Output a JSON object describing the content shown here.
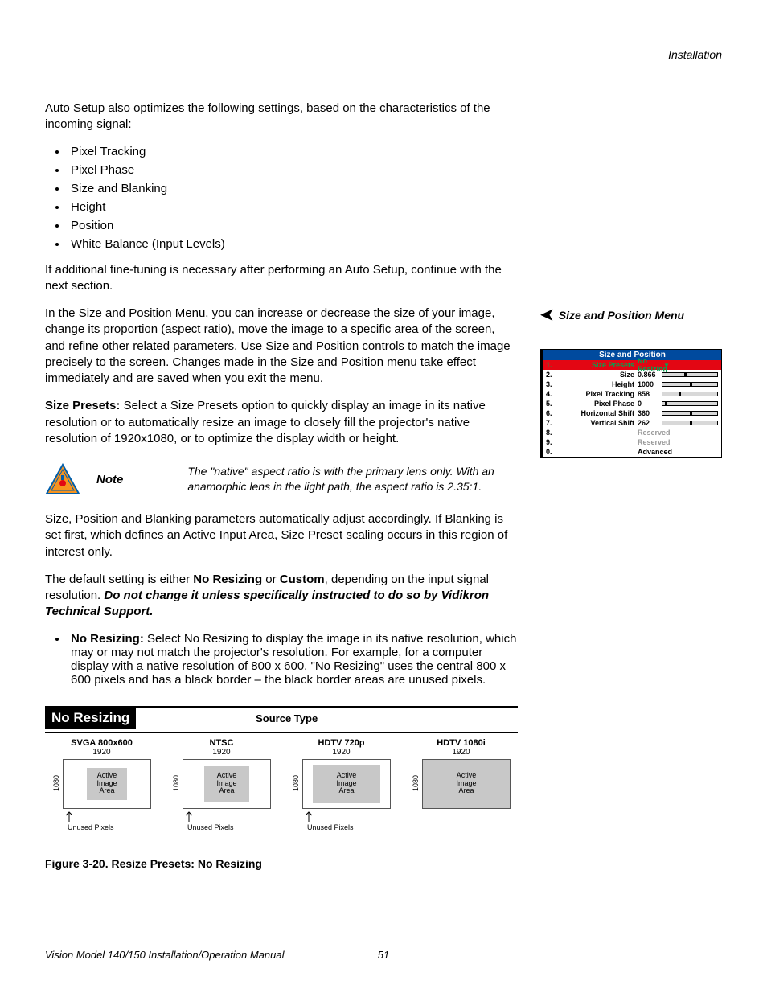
{
  "header": {
    "section": "Installation"
  },
  "intro": {
    "auto_setup": "Auto Setup also optimizes the following settings, based on the characteristics of the incoming signal:",
    "bullets": [
      "Pixel Tracking",
      "Pixel Phase",
      "Size and Blanking",
      "Height",
      "Position",
      "White Balance (Input Levels)"
    ],
    "fine_tune": "If additional fine-tuning is necessary after performing an Auto Setup, continue with the next section."
  },
  "size_pos": {
    "heading": "Size and Position Menu",
    "para": "In the Size and Position Menu, you can increase or decrease the size of your image, change its proportion (aspect ratio), move the image to a specific area of the screen, and refine other related parameters. Use Size and Position controls to match the image precisely to the screen. Changes made in the Size and Position menu take effect immediately and are saved when you exit the menu.",
    "presets_label": "Size Presets: ",
    "presets_text": "Select a Size Presets option to quickly display an image in its native resolution or to automatically resize an image to closely fill the projector's native resolution of 1920x1080, or to optimize the display width or height."
  },
  "note": {
    "label": "Note",
    "text": "The \"native\" aspect ratio is with the primary lens only. With an anamorphic lens in the light path, the aspect ratio is 2.35:1."
  },
  "blanking_para": "Size, Position and Blanking parameters automatically adjust accordingly. If Blanking is set first, which defines an Active Input Area, Size Preset scaling occurs in this region of interest only.",
  "default": {
    "pre": "The default setting is either ",
    "b1": "No Resizing",
    "mid": " or ",
    "b2": "Custom",
    "post": ", depending on the input signal resolution. ",
    "warn": "Do not change it unless specifically instructed to do so by Vidikron Technical Support."
  },
  "no_resize": {
    "label": "No Resizing: ",
    "text": "Select No Resizing to display the image in its native resolution, which may or may not match the projector's resolution. For example, for a computer display with a native resolution of 800 x 600, \"No Resizing\" uses the central 800 x 600 pixels and has a black border – the black border areas are unused pixels."
  },
  "menu": {
    "title": "Size and Position",
    "rows": [
      {
        "n": "1.",
        "label": "Size Presets",
        "value": "No Resizing",
        "hl": true,
        "slider": false,
        "dd": true
      },
      {
        "n": "2.",
        "label": "Size",
        "value": "0.866",
        "slider": true,
        "pos": 40
      },
      {
        "n": "3.",
        "label": "Height",
        "value": "1000",
        "slider": true,
        "pos": 50
      },
      {
        "n": "4.",
        "label": "Pixel Tracking",
        "value": "858",
        "slider": true,
        "pos": 30
      },
      {
        "n": "5.",
        "label": "Pixel Phase",
        "value": "0",
        "slider": true,
        "pos": 5
      },
      {
        "n": "6.",
        "label": "Horizontal Shift",
        "value": "360",
        "slider": true,
        "pos": 50
      },
      {
        "n": "7.",
        "label": "Vertical Shift",
        "value": "262",
        "slider": true,
        "pos": 50
      },
      {
        "n": "8.",
        "label": "",
        "reserved": "Reserved"
      },
      {
        "n": "9.",
        "label": "",
        "reserved": "Reserved"
      },
      {
        "n": "0.",
        "label": "",
        "advanced": "Advanced"
      }
    ]
  },
  "figure": {
    "badge": "No Resizing",
    "source": "Source Type",
    "width": "1920",
    "height": "1080",
    "active": "Active\nImage\nArea",
    "unused": "Unused Pixels",
    "panels": [
      {
        "type": "SVGA 800x600",
        "cls": "svga",
        "unused": true
      },
      {
        "type": "NTSC",
        "cls": "ntsc",
        "unused": true
      },
      {
        "type": "HDTV 720p",
        "cls": "p720",
        "unused": true
      },
      {
        "type": "HDTV 1080i",
        "cls": "i1080",
        "unused": false
      }
    ],
    "caption": "Figure 3-20. Resize Presets: No Resizing"
  },
  "footer": {
    "title": "Vision Model 140/150 Installation/Operation Manual",
    "page": "51"
  }
}
